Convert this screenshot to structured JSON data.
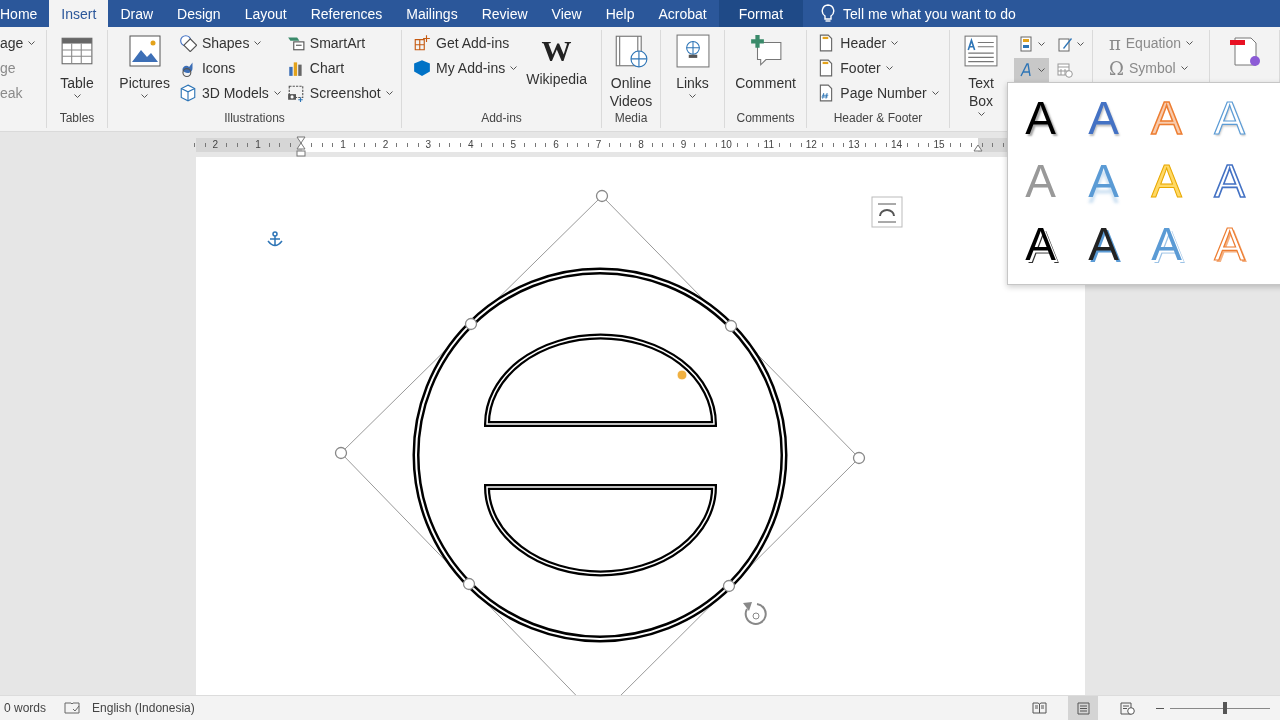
{
  "tabs": [
    {
      "label": "Home",
      "selected": false,
      "contextual": false
    },
    {
      "label": "Insert",
      "selected": true,
      "contextual": false
    },
    {
      "label": "Draw",
      "selected": false,
      "contextual": false
    },
    {
      "label": "Design",
      "selected": false,
      "contextual": false
    },
    {
      "label": "Layout",
      "selected": false,
      "contextual": false
    },
    {
      "label": "References",
      "selected": false,
      "contextual": false
    },
    {
      "label": "Mailings",
      "selected": false,
      "contextual": false
    },
    {
      "label": "Review",
      "selected": false,
      "contextual": false
    },
    {
      "label": "View",
      "selected": false,
      "contextual": false
    },
    {
      "label": "Help",
      "selected": false,
      "contextual": false
    },
    {
      "label": "Acrobat",
      "selected": false,
      "contextual": false
    },
    {
      "label": "Format",
      "selected": false,
      "contextual": true
    }
  ],
  "tell_me": {
    "placeholder": "Tell me what you want to do"
  },
  "ribbon": {
    "groups": [
      {
        "columns": [
          {
            "kind": "stack",
            "items": [
              {
                "label": "age",
                "caret": true,
                "disabled": false
              },
              {
                "label": "ge",
                "caret": false,
                "disabled": true
              },
              {
                "label": "eak",
                "caret": false,
                "disabled": true
              }
            ]
          }
        ]
      },
      {
        "label": "Tables",
        "columns": [
          {
            "kind": "large",
            "items": [
              {
                "label": "Table",
                "caret": true,
                "disabled": false
              }
            ]
          }
        ]
      },
      {
        "label": "Illustrations",
        "columns": [
          {
            "kind": "large",
            "items": [
              {
                "label": "Pictures",
                "caret": true,
                "disabled": false
              }
            ]
          },
          {
            "kind": "stack",
            "items": [
              {
                "label": "Shapes",
                "caret": true,
                "disabled": false
              },
              {
                "label": "Icons",
                "caret": false,
                "disabled": false
              },
              {
                "label": "3D Models",
                "caret": true,
                "disabled": false
              }
            ]
          },
          {
            "kind": "stack",
            "items": [
              {
                "label": "SmartArt",
                "caret": false,
                "disabled": false
              },
              {
                "label": "Chart",
                "caret": false,
                "disabled": false
              },
              {
                "label": "Screenshot",
                "caret": true,
                "disabled": false
              }
            ]
          }
        ]
      },
      {
        "label": "Add-ins",
        "columns": [
          {
            "kind": "stack",
            "items": [
              {
                "label": "Get Add-ins",
                "caret": false,
                "disabled": false
              },
              {
                "label": "My Add-ins",
                "caret": true,
                "disabled": false
              }
            ]
          },
          {
            "kind": "large",
            "items": [
              {
                "label": "Wikipedia",
                "logo": "W",
                "caret": false,
                "disabled": false
              }
            ]
          }
        ]
      },
      {
        "label": "Media",
        "columns": [
          {
            "kind": "large",
            "items": [
              {
                "label": "Online Videos",
                "caret": false,
                "disabled": false
              }
            ]
          }
        ]
      },
      {
        "columns": [
          {
            "kind": "large",
            "items": [
              {
                "label": "Links",
                "caret": true,
                "disabled": false
              }
            ]
          }
        ]
      },
      {
        "label": "Comments",
        "columns": [
          {
            "kind": "large",
            "items": [
              {
                "label": "Comment",
                "caret": false,
                "disabled": false
              }
            ]
          }
        ]
      },
      {
        "label": "Header & Footer",
        "columns": [
          {
            "kind": "stack",
            "items": [
              {
                "label": "Header",
                "caret": true,
                "disabled": false
              },
              {
                "label": "Footer",
                "caret": true,
                "disabled": false
              },
              {
                "label": "Page Number",
                "caret": true,
                "disabled": false
              }
            ]
          }
        ]
      },
      {
        "columns": [
          {
            "kind": "large",
            "items": [
              {
                "label": "Text Box",
                "caret": true,
                "disabled": false
              }
            ]
          },
          {
            "kind": "icons",
            "items": [
              {
                "caret": true,
                "selected": false
              },
              {
                "caret": true,
                "selected": false
              },
              {
                "caret": true,
                "selected": true
              },
              {
                "caret": false,
                "selected": false
              }
            ]
          }
        ]
      },
      {
        "columns": [
          {
            "kind": "stack",
            "items": [
              {
                "label": "Equation",
                "glyph": "π",
                "caret": true,
                "disabled": true
              },
              {
                "label": "Symbol",
                "glyph": "Ω",
                "caret": true,
                "disabled": true
              }
            ]
          }
        ]
      },
      {
        "columns": [
          {
            "kind": "large",
            "items": [
              {
                "caret": false,
                "disabled": false
              }
            ]
          }
        ]
      }
    ]
  },
  "ruler": {
    "left_numbers": [
      "2",
      "1"
    ],
    "numbers": [
      "1",
      "2",
      "3",
      "4",
      "5",
      "6",
      "7",
      "8",
      "9",
      "10",
      "11",
      "12",
      "13",
      "14",
      "15"
    ]
  },
  "wordart_gallery": [
    {
      "label": "A",
      "kind": "plain"
    },
    {
      "label": "A",
      "kind": "fill-blue"
    },
    {
      "label": "A",
      "kind": "outline-orange"
    },
    {
      "label": "A",
      "kind": "outline-blue"
    },
    {
      "label": "A",
      "kind": "gradient-gray"
    },
    {
      "label": "A",
      "kind": "reflect-blue"
    },
    {
      "label": "A",
      "kind": "fill-yellow"
    },
    {
      "label": "A",
      "kind": "outline-blue-bold"
    },
    {
      "label": "A",
      "kind": "shadow-black"
    },
    {
      "label": "A",
      "kind": "shadow-blue"
    },
    {
      "label": "A",
      "kind": "bevel-blue"
    },
    {
      "label": "A",
      "kind": "outline-orange-thin"
    }
  ],
  "status_bar": {
    "words": "0 words",
    "language": "English (Indonesia)",
    "views": [
      {
        "selected": false
      },
      {
        "selected": true
      },
      {
        "selected": false
      }
    ],
    "zoom": {
      "level": 0.55
    }
  }
}
